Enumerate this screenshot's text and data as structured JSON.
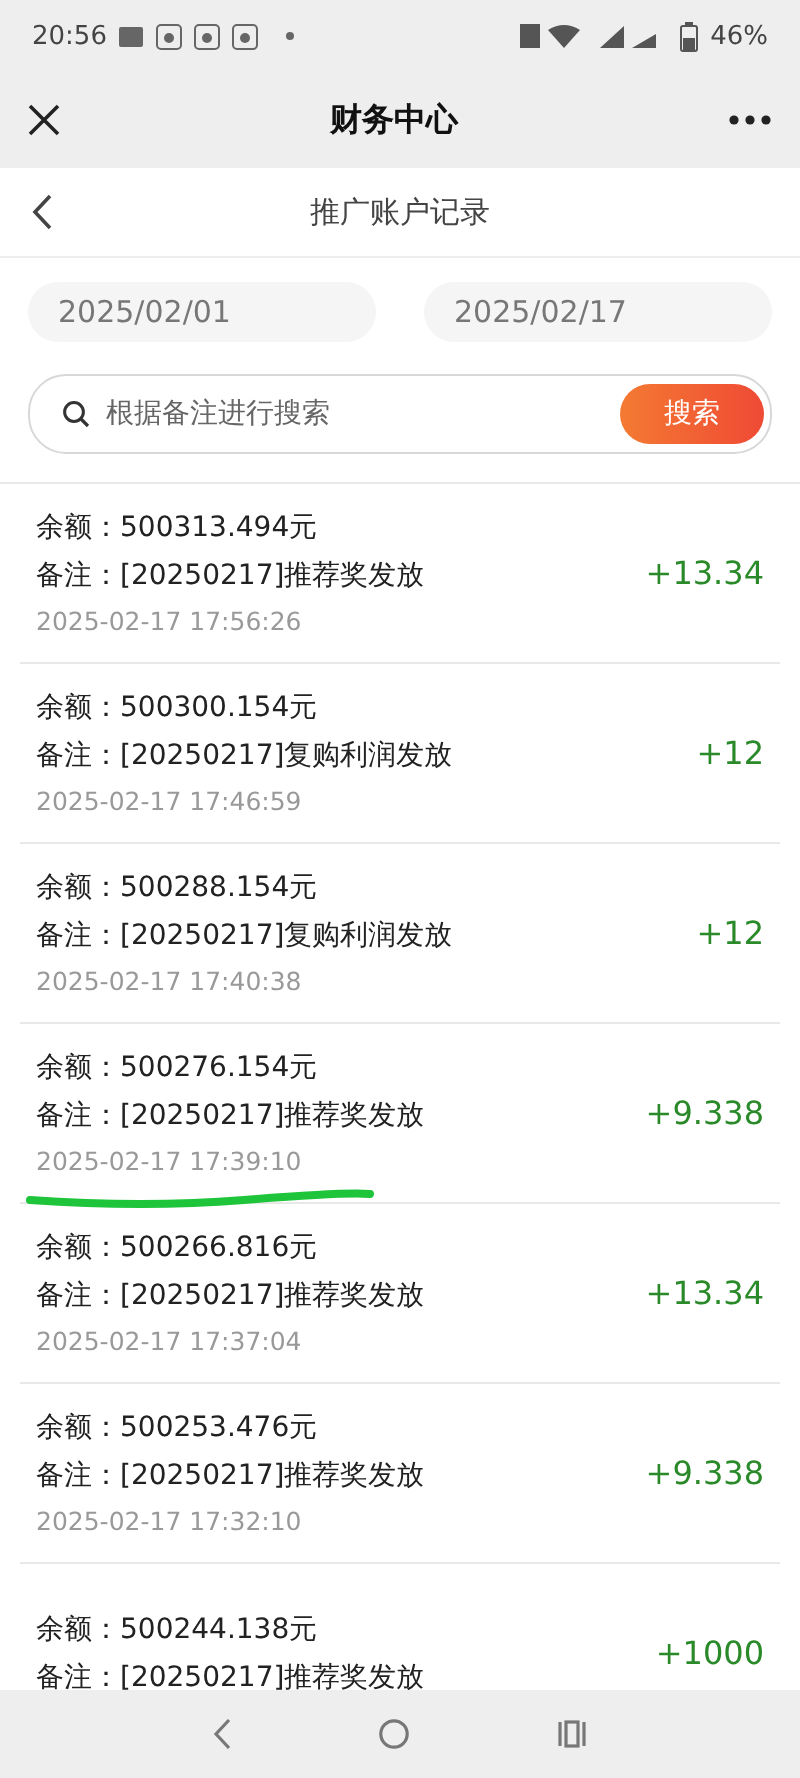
{
  "status_bar": {
    "time": "20:56",
    "battery": "46%"
  },
  "header": {
    "title": "财务中心"
  },
  "sub_header": {
    "title": "推广账户记录"
  },
  "date_range": {
    "start": "2025/02/01",
    "end": "2025/02/17"
  },
  "search": {
    "placeholder": "根据备注进行搜索",
    "button": "搜索"
  },
  "records": [
    {
      "balance": "余额：500313.494元",
      "remark": "备注：[20250217]推荐奖发放",
      "time": "2025-02-17 17:56:26",
      "amount": "+13.34",
      "underlined": false
    },
    {
      "balance": "余额：500300.154元",
      "remark": "备注：[20250217]复购利润发放",
      "time": "2025-02-17 17:46:59",
      "amount": "+12",
      "underlined": false
    },
    {
      "balance": "余额：500288.154元",
      "remark": "备注：[20250217]复购利润发放",
      "time": "2025-02-17 17:40:38",
      "amount": "+12",
      "underlined": false
    },
    {
      "balance": "余额：500276.154元",
      "remark": "备注：[20250217]推荐奖发放",
      "time": "2025-02-17 17:39:10",
      "amount": "+9.338",
      "underlined": true
    },
    {
      "balance": "余额：500266.816元",
      "remark": "备注：[20250217]推荐奖发放",
      "time": "2025-02-17 17:37:04",
      "amount": "+13.34",
      "underlined": false
    },
    {
      "balance": "余额：500253.476元",
      "remark": "备注：[20250217]推荐奖发放",
      "time": "2025-02-17 17:32:10",
      "amount": "+9.338",
      "underlined": false
    },
    {
      "balance": "余额：500244.138元",
      "remark": "备注：[20250217]推荐奖发放",
      "amount": "+1000",
      "underlined": false
    }
  ]
}
